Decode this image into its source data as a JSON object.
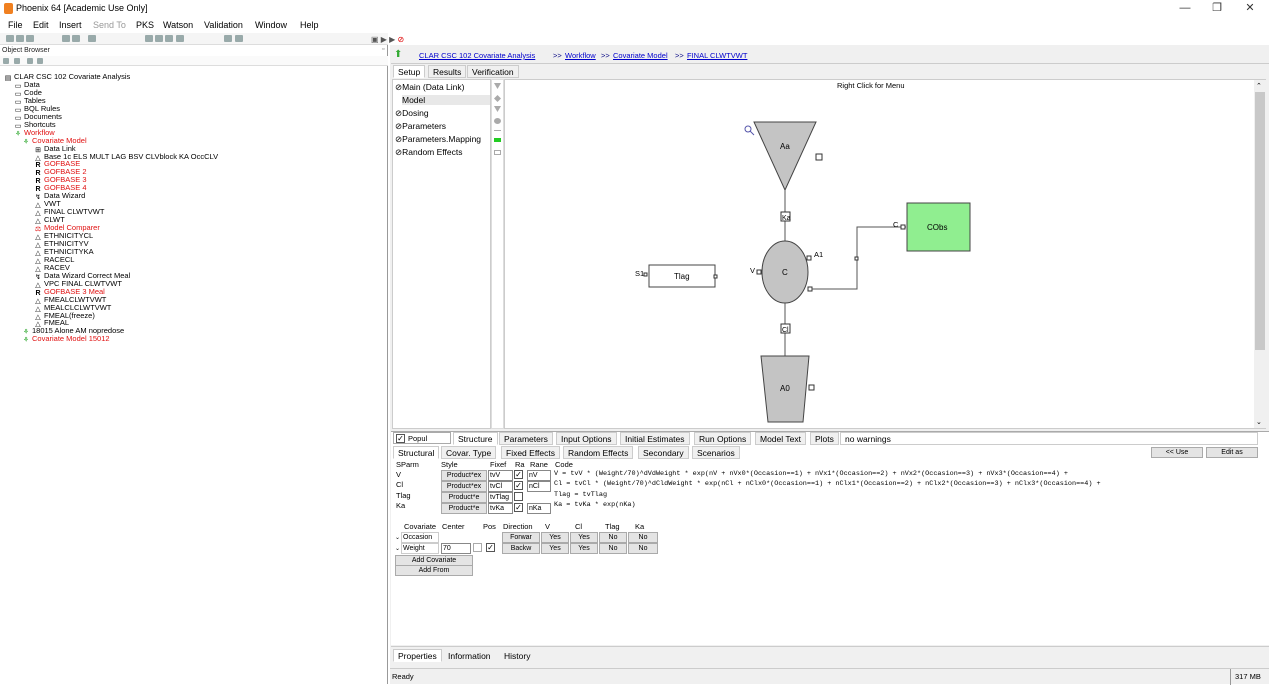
{
  "window": {
    "title": "Phoenix 64 [Academic Use Only]",
    "minimize": "—",
    "maximize": "❐",
    "close": "✕"
  },
  "menu": [
    "File",
    "Edit",
    "Insert",
    "Send To",
    "PKS",
    "Watson",
    "Validation",
    "Window",
    "Help"
  ],
  "object_browser": {
    "title": "Object Browser",
    "tree": [
      {
        "label": "CLAR  CSC  102 Covariate Analysis",
        "icon": "project-icon",
        "red": false
      },
      {
        "label": "Data",
        "icon": "folder-icon",
        "red": false
      },
      {
        "label": "Code",
        "icon": "folder-icon",
        "red": false
      },
      {
        "label": "Tables",
        "icon": "folder-icon",
        "red": false
      },
      {
        "label": "BQL Rules",
        "icon": "folder-icon",
        "red": false
      },
      {
        "label": "Documents",
        "icon": "folder-icon",
        "red": false
      },
      {
        "label": "Shortcuts",
        "icon": "folder-icon",
        "red": false
      },
      {
        "label": "Workflow",
        "icon": "workflow-icon",
        "red": true
      },
      {
        "label": "Covariate Model",
        "icon": "workflow-icon",
        "red": true
      },
      {
        "label": "Data Link",
        "icon": "data-link-icon",
        "red": false
      },
      {
        "label": "Base  1c ELS MULT LAG BSV CLVblock KA OccCLV",
        "icon": "model-icon",
        "red": false
      },
      {
        "label": "GOFBASE",
        "icon": "r-icon",
        "red": true
      },
      {
        "label": "GOFBASE  2",
        "icon": "r-icon",
        "red": true
      },
      {
        "label": "GOFBASE  3",
        "icon": "r-icon",
        "red": true
      },
      {
        "label": "GOFBASE  4",
        "icon": "r-icon",
        "red": true
      },
      {
        "label": "Data Wizard",
        "icon": "wizard-icon",
        "red": false
      },
      {
        "label": "VWT",
        "icon": "model-icon",
        "red": false
      },
      {
        "label": "FINAL  CLWTVWT",
        "icon": "model-icon",
        "red": false
      },
      {
        "label": "CLWT",
        "icon": "model-icon",
        "red": false
      },
      {
        "label": "Model Comparer",
        "icon": "comparer-icon",
        "red": true
      },
      {
        "label": "ETHNICITYCL",
        "icon": "model-icon",
        "red": false
      },
      {
        "label": "ETHNICITYV",
        "icon": "model-icon",
        "red": false
      },
      {
        "label": "ETHNICITYKA",
        "icon": "model-icon",
        "red": false
      },
      {
        "label": "RACECL",
        "icon": "model-icon",
        "red": false
      },
      {
        "label": "RACEV",
        "icon": "model-icon",
        "red": false
      },
      {
        "label": "Data Wizard  Correct Meal",
        "icon": "wizard-icon",
        "red": false
      },
      {
        "label": "VPC FINAL  CLWTVWT",
        "icon": "model-icon",
        "red": false
      },
      {
        "label": "GOFBASE  3  Meal",
        "icon": "r-icon",
        "red": true
      },
      {
        "label": "FMEALCLWTVWT",
        "icon": "model-icon",
        "red": false
      },
      {
        "label": "MEALCLCLWTVWT",
        "icon": "model-icon",
        "red": false
      },
      {
        "label": "FMEAL(freeze)",
        "icon": "model-icon",
        "red": false
      },
      {
        "label": "FMEAL",
        "icon": "model-icon",
        "red": false
      },
      {
        "label": "18015 Alone  AM  nopredose",
        "icon": "workflow-icon",
        "red": false
      },
      {
        "label": "Covariate Model  15012",
        "icon": "workflow-icon",
        "red": true
      }
    ]
  },
  "breadcrumb": {
    "items": [
      "CLAR  CSC  102 Covariate Analysis",
      "Workflow",
      "Covariate Model",
      "FINAL  CLWTVWT"
    ],
    "sep": ">>"
  },
  "top_tabs": [
    "Setup",
    "Results",
    "Verification"
  ],
  "setup_list": [
    "Main (Data Link)",
    "Model",
    "Dosing",
    "Parameters",
    "Parameters.Mapping",
    "Random Effects"
  ],
  "canvas": {
    "hint": "Right Click for Menu",
    "nodes": {
      "Aa": "Aa",
      "Ka": "Ka",
      "C": "C",
      "A1": "A1",
      "V": "V",
      "S1": "S1",
      "Tlag": "Tlag",
      "Cl": "Cl",
      "A0": "A0",
      "Cobs_prefix": "C",
      "Cobs": "CObs"
    }
  },
  "model_tabs": {
    "popul": "Popul",
    "tabs": [
      "Structure",
      "Parameters",
      "Input Options",
      "Initial Estimates",
      "Run Options",
      "Model Text",
      "Plots",
      "no warnings"
    ]
  },
  "sub_tabs": [
    "Structural",
    "Covar. Type",
    "Fixed Effects",
    "Random Effects",
    "Secondary",
    "Scenarios"
  ],
  "side_buttons": {
    "use": "<< Use",
    "edit": "Edit as"
  },
  "param_headers": [
    "SParm",
    "Style",
    "Fixef",
    "Ra",
    "Rane",
    "Code"
  ],
  "params": [
    {
      "name": "V",
      "style": "Product*ex",
      "fixef": "tvV",
      "rane": "nV",
      "code": "V = tvV * (Weight/70)^dVdWeight * exp(nV + nVx0*(Occasion==1) + nVx1*(Occasion==2) + nVx2*(Occasion==3) + nVx3*(Occasion==4) +"
    },
    {
      "name": "Cl",
      "style": "Product*ex",
      "fixef": "tvCl",
      "rane": "nCl",
      "code": "Cl = tvCl * (Weight/70)^dCldWeight * exp(nCl + nClx0*(Occasion==1) + nClx1*(Occasion==2) + nClx2*(Occasion==3) + nClx3*(Occasion==4) +"
    },
    {
      "name": "Tlag",
      "style": "Product*e",
      "fixef": "tvTlag",
      "rane": "",
      "code": "Tlag = tvTlag"
    },
    {
      "name": "Ka",
      "style": "Product*e",
      "fixef": "tvKa",
      "rane": "nKa",
      "code": "Ka = tvKa * exp(nKa)"
    }
  ],
  "cov_headers": [
    "Covariate",
    "Center",
    "Pos",
    "Direction",
    "V",
    "Cl",
    "Tlag",
    "Ka"
  ],
  "covariates": [
    {
      "name": "Occasion",
      "center": "",
      "direction": "Forwar",
      "v": "Yes",
      "cl": "Yes",
      "tlag": "No",
      "ka": "No"
    },
    {
      "name": "Weight",
      "center": "70",
      "direction": "Backw",
      "v": "Yes",
      "cl": "Yes",
      "tlag": "No",
      "ka": "No"
    }
  ],
  "cov_buttons": {
    "add_cov": "Add Covariate",
    "add_from": "Add From"
  },
  "bottom_tabs": [
    "Properties",
    "Information",
    "History"
  ],
  "status": {
    "text": "Ready",
    "mem": "317 MB"
  }
}
